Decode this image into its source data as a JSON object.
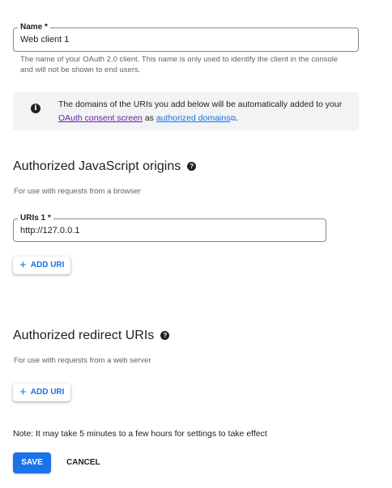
{
  "name_field": {
    "label": "Name *",
    "value": "Web client 1",
    "help": "The name of your OAuth 2.0 client. This name is only used to identify the client in the console and will not be shown to end users."
  },
  "info": {
    "text_before": "The domains of the URIs you add below will be automatically added to your",
    "link1": "OAuth consent screen",
    "middle": "as",
    "link2": "authorized domains",
    "end": "."
  },
  "js_origins": {
    "title": "Authorized JavaScript origins",
    "help": "For use with requests from a browser",
    "uri_label": "URIs 1 *",
    "uri_value": "http://127.0.0.1",
    "add_button": "ADD URI"
  },
  "redirect_uris": {
    "title": "Authorized redirect URIs",
    "help": "For use with requests from a web server",
    "add_button": "ADD URI"
  },
  "note": "Note: It may take 5 minutes to a few hours for settings to take effect",
  "actions": {
    "save": "SAVE",
    "cancel": "CANCEL"
  },
  "colors": {
    "primary": "#1a73e8",
    "info_background": "#f1f3f4",
    "visited_link": "#681da8"
  },
  "icons": [
    "info-icon",
    "help-icon",
    "plus-icon",
    "external-link-icon"
  ]
}
